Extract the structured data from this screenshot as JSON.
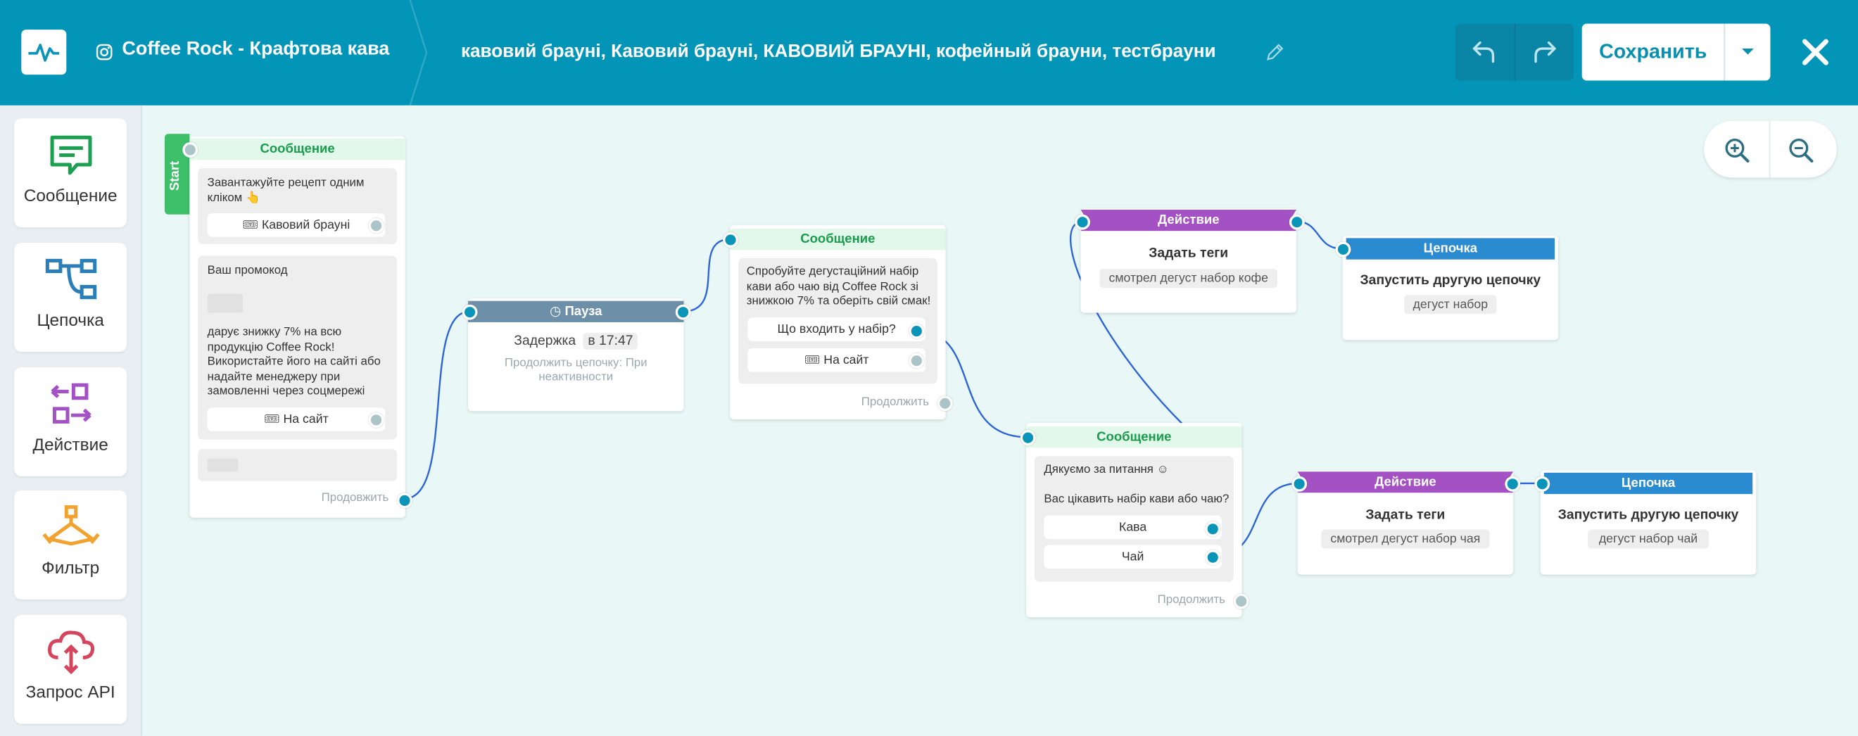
{
  "header": {
    "app_title": "Coffee Rock - Крафтова кава",
    "flow_name": "кавовий брауні, Кавовий брауні, КАВОВИЙ БРАУНІ, кофейный брауни, тестбрауни",
    "save_label": "Сохранить",
    "icons": [
      "logo-icon",
      "instagram-icon",
      "pencil-icon",
      "undo-icon",
      "redo-icon",
      "chevron-down-icon",
      "close-icon"
    ]
  },
  "sidebar": {
    "items": [
      {
        "label": "Сообщение",
        "icon": "message-icon",
        "color": "#1aa050"
      },
      {
        "label": "Цепочка",
        "icon": "chain-icon",
        "color": "#2a7fb8"
      },
      {
        "label": "Действие",
        "icon": "action-icon",
        "color": "#a452c3"
      },
      {
        "label": "Фильтр",
        "icon": "filter-icon",
        "color": "#f2a22e"
      },
      {
        "label": "Запрос API",
        "icon": "api-icon",
        "color": "#d6455e"
      }
    ]
  },
  "canvas": {
    "start_label": "Start",
    "n1": {
      "header": "Сообщение",
      "block1_text": "Завантажуйте рецепт одним кліком 👆",
      "block1_button": "Кавовий брауні",
      "block2_text1": "Ваш промокод",
      "block2_text2": "дарує знижку 7% на всю продукцію Coffee Rock! Використайте його на сайті або надайте менеджеру при замовленні через соцмережі",
      "block2_button": "На сайт",
      "continue": "Продовжить"
    },
    "n2": {
      "header": "Пауза",
      "delay_label": "Задержка",
      "delay_value": "в 17:47",
      "note": "Продолжить цепочку: При неактивности"
    },
    "n3": {
      "header": "Сообщение",
      "text": "Спробуйте дегустаційний набір кави або чаю від Coffee Rock зі знижкою 7% та оберіть свій смак!",
      "button1": "Що входить у набір?",
      "button2": "На сайт",
      "continue": "Продолжить"
    },
    "n4": {
      "header": "Сообщение",
      "text1": "Дякуємо за питання ☺",
      "text2": "Вас цікавить набір кави або чаю?",
      "button1": "Кава",
      "button2": "Чай",
      "continue": "Продолжить"
    },
    "n5": {
      "header": "Действие",
      "title": "Задать теги",
      "tag": "смотрел дегуст набор кофе"
    },
    "n6": {
      "header": "Цепочка",
      "title": "Запустить другую цепочку",
      "tag": "дегуст набор"
    },
    "n7": {
      "header": "Действие",
      "title": "Задать теги",
      "tag": "смотрел дегуст набор чая"
    },
    "n8": {
      "header": "Цепочка",
      "title": "Запустить другую цепочку",
      "tag": "дегуст набор чай"
    }
  },
  "colors": {
    "topbar": "#0395b8",
    "canvas": "#e9f7f7",
    "port": "#0a95b8",
    "edge": "#2b63d9"
  }
}
